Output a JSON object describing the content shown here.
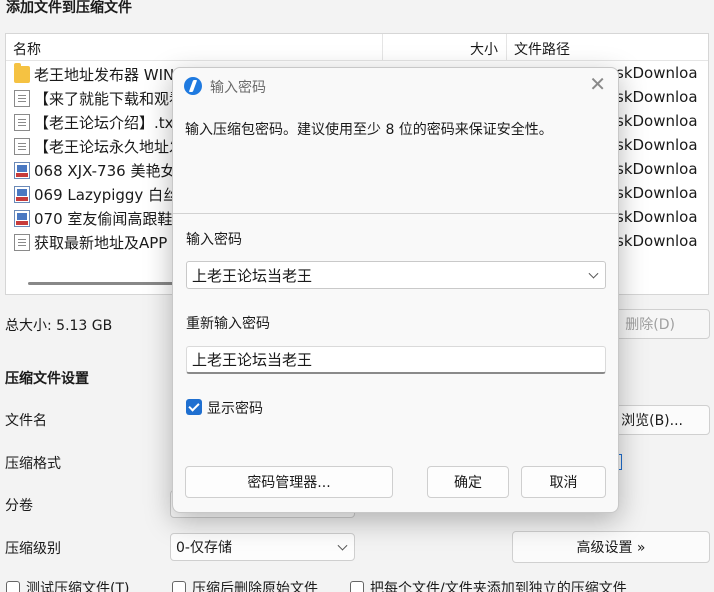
{
  "main": {
    "section_title": "添加文件到压缩文件",
    "file_list": {
      "columns": {
        "name": "名称",
        "size": "大小",
        "path": "文件路径"
      },
      "rows": [
        {
          "icon": "folder-icon",
          "name": "老王地址发布器 WIN",
          "path": "skDownloa"
        },
        {
          "icon": "text-file-icon",
          "name": "【来了就能下载和观看",
          "path": "skDownloa"
        },
        {
          "icon": "text-file-icon",
          "name": "【老王论坛介绍】.txt",
          "path": "skDownloa"
        },
        {
          "icon": "text-file-icon",
          "name": "【老王论坛永久地址发",
          "path": "skDownloa"
        },
        {
          "icon": "image-file-icon",
          "name": "068 XJX-736 美艳女",
          "path": "skDownloa"
        },
        {
          "icon": "image-file-icon",
          "name": "069 Lazypiggy 白丝",
          "path": "skDownloa"
        },
        {
          "icon": "image-file-icon",
          "name": "070 室友偷闻高跟鞋",
          "path": "skDownloa"
        },
        {
          "icon": "text-file-icon",
          "name": "获取最新地址及APP",
          "path": "skDownloa"
        }
      ]
    },
    "total_size": "总大小: 5.13 GB",
    "delete_button": "删除(D)",
    "settings": {
      "title": "压缩文件设置",
      "filename_label": "文件名",
      "browse_button": "浏览(B)...",
      "format_label": "压缩格式",
      "split_label": "分卷",
      "level_label": "压缩级别",
      "level_value": "0-仅存储",
      "advanced_button": "高级设置 »"
    },
    "options": {
      "test_archive": "测试压缩文件(T)",
      "delete_after": "压缩后删除原始文件",
      "separate_archives": "把每个文件/文件夹添加到独立的压缩文件"
    }
  },
  "dialog": {
    "title": "输入密码",
    "description": "输入压缩包密码。建议使用至少 8 位的密码来保证安全性。",
    "password_label": "输入密码",
    "password_value": "上老王论坛当老王",
    "reenter_label": "重新输入密码",
    "reenter_value": "上老王论坛当老王",
    "show_password_label": "显示密码",
    "show_password_checked": true,
    "manager_button": "密码管理器...",
    "ok_button": "确定",
    "cancel_button": "取消"
  },
  "colors": {
    "accent": "#1f6fd0",
    "background": "#f3f3f3"
  }
}
